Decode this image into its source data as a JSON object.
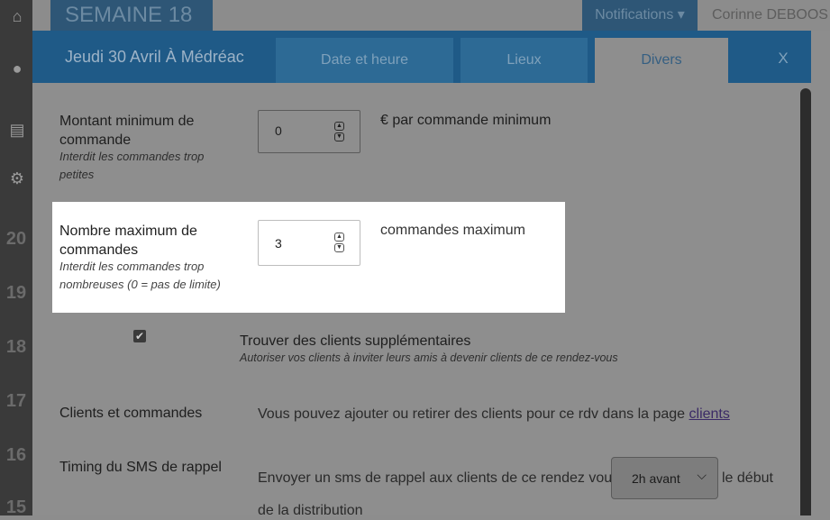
{
  "background": {
    "page_title": "SEMAINE 18",
    "notifications_label": "Notifications",
    "user_name": "Corinne DEBOOS",
    "sidebar_weeks": [
      "20",
      "19",
      "18",
      "17",
      "16",
      "15"
    ]
  },
  "modal": {
    "title": "Jeudi 30 Avril À Médréac",
    "tabs": [
      "Date et heure",
      "Lieux",
      "Divers"
    ],
    "active_tab": "Divers",
    "close_label": "X"
  },
  "form": {
    "min_order": {
      "label": "Montant minimum de commande",
      "label_line1": "Montant minimum de",
      "label_line2": "commande",
      "hint_line1": "Interdit les commandes trop",
      "hint_line2": "petites",
      "value": "0",
      "suffix": "€ par commande minimum"
    },
    "max_orders": {
      "label_line1": "Nombre maximum de",
      "label_line2": "commandes",
      "hint_line1": "Interdit les commandes trop",
      "hint_line2": "nombreuses (0 = pas de limite)",
      "value": "3",
      "suffix": "commandes maximum"
    },
    "extra_clients": {
      "checked": true,
      "label": "Trouver des clients supplémentaires",
      "hint": "Autoriser vos clients à inviter leurs amis à devenir clients de ce rendez-vous"
    },
    "clients_orders": {
      "label": "Clients et commandes",
      "text": "Vous pouvez ajouter ou retirer des clients pour ce rdv dans la page",
      "link": "clients"
    },
    "sms_timing": {
      "label": "Timing du SMS de rappel",
      "text_before": "Envoyer un sms de rappel aux clients de ce rendez vous",
      "select_value": "2h avant",
      "text_after": "le début",
      "text_line2": "de la distribution"
    }
  }
}
